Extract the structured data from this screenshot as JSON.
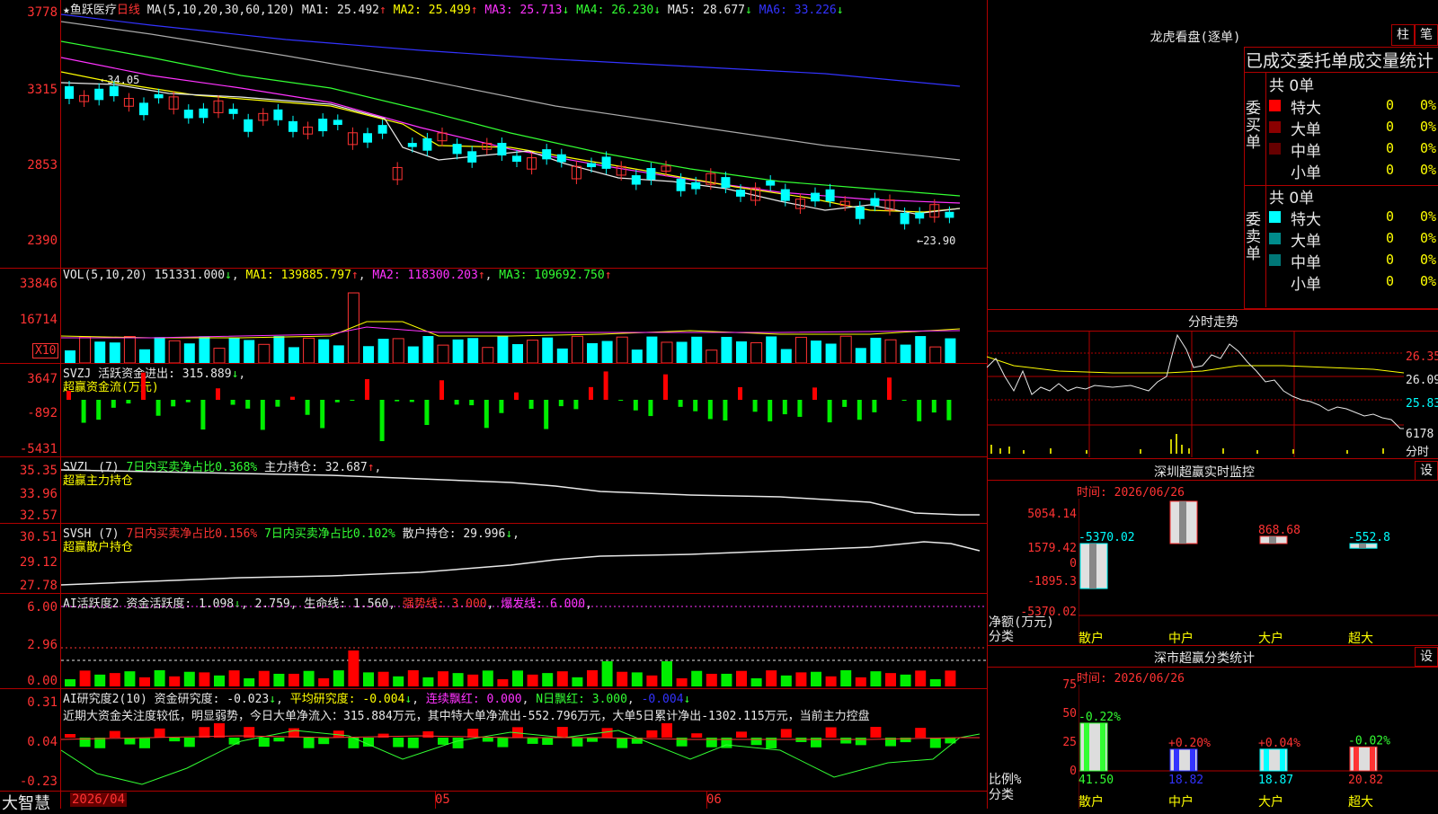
{
  "main_chart": {
    "star": "★",
    "stock_name": "鱼跃医疗",
    "period": "日线",
    "ma_params": "MA(5,10,20,30,60,120)",
    "ma1": "MA1: 25.492",
    "ma2": "MA2: 25.499",
    "ma3": "MA3: 25.713",
    "ma4": "MA4: 26.230",
    "ma5": "MA5: 28.677",
    "ma6": "MA6: 33.226",
    "arrow_up": "↑",
    "arrow_down": "↓",
    "y_labels": [
      "3778",
      "3315",
      "2853",
      "2390"
    ],
    "high_marker": "←34.05",
    "low_marker": "←23.90",
    "ma_colors": {
      "ma1": "#e8e8e8",
      "ma2": "#ffff00",
      "ma3": "#ff33ff",
      "ma4": "#33ff33",
      "ma5": "#bbbbbb",
      "ma6": "#3333ff"
    }
  },
  "vol_panel": {
    "label": "VOL(5,10,20)",
    "value": "151331.000",
    "ma1": "MA1: 139885.797",
    "ma2": "MA2: 118300.203",
    "ma3": "MA3: 109692.750",
    "y_labels": [
      "33846",
      "16714"
    ],
    "unit_badge": "X10"
  },
  "svzj_panel": {
    "label": "SVZJ",
    "text": "活跃资金进出: 315.889",
    "subtitle": "超赢资金流(万元)",
    "y_labels": [
      "3647",
      "-892",
      "-5431"
    ]
  },
  "svzl_panel": {
    "label": "SVZL (7)",
    "text1": "7日内买卖净占比0.368%",
    "text2": "主力持仓: 32.687",
    "subtitle": "超赢主力持仓",
    "y_labels": [
      "35.35",
      "33.96",
      "32.57"
    ]
  },
  "svsh_panel": {
    "label": "SVSH (7)",
    "text1": "7日内买卖净占比0.156%",
    "text2": "7日内买卖净占比0.102%",
    "text3": "散户持仓: 29.996",
    "subtitle": "超赢散户持仓",
    "y_labels": [
      "30.51",
      "29.12",
      "27.78"
    ]
  },
  "ai_active_panel": {
    "label": "AI活跃度2",
    "text1": "资金活跃度: 1.098",
    "text2": "2.759",
    "text3": "生命线: 1.560",
    "text4": "强势线: 3.000",
    "text5": "爆发线: 6.000",
    "y_labels": [
      "6.00",
      "2.96",
      "0.00"
    ]
  },
  "ai_research_panel": {
    "label": "AI研究度2(10)",
    "text1": "资金研究度: -0.023",
    "text2": "平均研究度: -0.004",
    "text3": "连续飘红: 0.000",
    "text4": "N日飘红: 3.000",
    "text5": "-0.004",
    "comment": "近期大资金关注度较低，明显弱势，今日大单净流入：315.884万元，其中特大单净流出-552.796万元，大单5日累计净出-1302.115万元，当前主力控盘",
    "y_labels": [
      "0.31",
      "0.04",
      "-0.23"
    ]
  },
  "bottom_bar": {
    "brand": "大智慧",
    "dates": [
      "2026/04",
      "05",
      "06"
    ]
  },
  "right_panel": {
    "dragon_title": "龙虎看盘(逐单)",
    "btn_zhu": "柱",
    "btn_bi": "笔",
    "stats_title": "已成交委托单成交量统计",
    "buy_side": {
      "side_label": "委买单",
      "total": "共 0单",
      "rows": [
        {
          "name": "特大",
          "count": "0",
          "pct": "0%"
        },
        {
          "name": "大单",
          "count": "0",
          "pct": "0%"
        },
        {
          "name": "中单",
          "count": "0",
          "pct": "0%"
        },
        {
          "name": "小单",
          "count": "0",
          "pct": "0%"
        }
      ],
      "colors": [
        "#ff0000",
        "#8b0000",
        "#6b0000",
        "#000000"
      ]
    },
    "sell_side": {
      "side_label": "委卖单",
      "total": "共 0单",
      "rows": [
        {
          "name": "特大",
          "count": "0",
          "pct": "0%"
        },
        {
          "name": "大单",
          "count": "0",
          "pct": "0%"
        },
        {
          "name": "中单",
          "count": "0",
          "pct": "0%"
        },
        {
          "name": "小单",
          "count": "0",
          "pct": "0%"
        }
      ],
      "colors": [
        "#00ffff",
        "#008b8b",
        "#007777",
        "#000000"
      ]
    },
    "intraday": {
      "title": "分时走势",
      "y_labels": [
        "26.35",
        "26.09",
        "25.83"
      ],
      "vol_label": "6178",
      "fen_label": "分时"
    },
    "monitor": {
      "title": "深圳超赢实时监控",
      "set_btn": "设",
      "time": "时间: 2026/06/26",
      "y_labels": [
        "5054.14",
        "1579.42",
        "0",
        "-1895.3",
        "-5370.02"
      ],
      "axis_caption1": "净额(万元)",
      "axis_caption2": "分类",
      "categories": [
        "散户",
        "中户",
        "大户",
        "超大"
      ],
      "values": [
        -5370.02,
        5054.14,
        868.68,
        -552.8
      ],
      "value_labels": [
        "-5370.02",
        "5054.14",
        "868.68",
        "-552.8"
      ]
    },
    "classify": {
      "title": "深市超赢分类统计",
      "set_btn": "设",
      "time": "时间: 2026/06/26",
      "y_labels": [
        "75",
        "50",
        "25",
        "0"
      ],
      "axis_caption1": "比例%",
      "axis_caption2": "分类",
      "categories": [
        "散户",
        "中户",
        "大户",
        "超大"
      ],
      "values": [
        41.5,
        18.82,
        18.87,
        20.82
      ],
      "value_labels": [
        "41.50",
        "18.82",
        "18.87",
        "20.82"
      ],
      "change_labels": [
        "-0.22%",
        "+0.20%",
        "+0.04%",
        "-0.02%"
      ]
    }
  }
}
